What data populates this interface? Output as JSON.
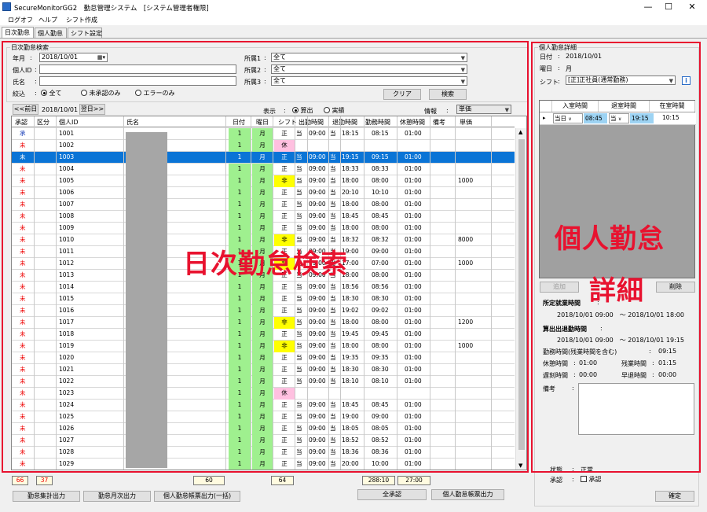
{
  "window": {
    "title": "SecureMonitorGG2　勤怠管理システム　[システム管理者権限]",
    "minimize": "—",
    "maximize": "☐",
    "close": "✕"
  },
  "menu": [
    "ログオフ",
    "ヘルプ",
    "シフト作成"
  ],
  "tabs": [
    "日次勤怠",
    "個人勤怠",
    "シフト設定"
  ],
  "overlays": {
    "search": "日次勤怠検索",
    "detail_line1": "個人勤怠",
    "detail_line2": "詳細"
  },
  "search": {
    "group_title": "日次勤怠検索",
    "year_month_label": "年月",
    "year_month_value": "2018/10/01",
    "personal_id_label": "個人ID",
    "name_label": "氏名",
    "filter_label": "絞込",
    "radio_all": "全て",
    "radio_unapproved": "未承認のみ",
    "radio_error": "エラーのみ",
    "dept1_label": "所属1",
    "dept2_label": "所属2",
    "dept3_label": "所属3",
    "dept1_value": "全て",
    "dept2_value": "全て",
    "dept3_value": "全て",
    "clear_button": "クリア",
    "search_button": "検索",
    "prev_day": "<<前日",
    "date_display": "2018/10/01",
    "next_day": "翌日>>",
    "display_label": "表示",
    "display_calc": "算出",
    "display_actual": "実績",
    "info_label": "情報",
    "info_value": "単価"
  },
  "columns": [
    "承認",
    "区分",
    "個人ID",
    "氏名",
    "日付",
    "曜日",
    "シフト",
    "出勤時間",
    "退勤時間",
    "勤務時間",
    "休憩時間",
    "備考",
    "単価"
  ],
  "rows": [
    {
      "approval": "承",
      "id": "1001",
      "date": "1",
      "dow": "月",
      "shift": "正",
      "shift_color": "",
      "in_flag": "当",
      "in": "09:00",
      "out_flag": "当",
      "out": "18:15",
      "work": "08:15",
      "rest": "01:00",
      "price": ""
    },
    {
      "approval": "未",
      "id": "1002",
      "date": "1",
      "dow": "月",
      "shift": "休",
      "shift_color": "pink",
      "in_flag": "",
      "in": "",
      "out_flag": "",
      "out": "",
      "work": "",
      "rest": "",
      "price": ""
    },
    {
      "approval": "未",
      "id": "1003",
      "date": "1",
      "dow": "月",
      "shift": "正",
      "shift_color": "",
      "in_flag": "当",
      "in": "09:00",
      "out_flag": "当",
      "out": "19:15",
      "work": "09:15",
      "rest": "01:00",
      "price": "",
      "selected": true
    },
    {
      "approval": "未",
      "id": "1004",
      "date": "1",
      "dow": "月",
      "shift": "正",
      "shift_color": "",
      "in_flag": "当",
      "in": "09:00",
      "out_flag": "当",
      "out": "18:33",
      "work": "08:33",
      "rest": "01:00",
      "price": ""
    },
    {
      "approval": "未",
      "id": "1005",
      "date": "1",
      "dow": "月",
      "shift": "非",
      "shift_color": "yellow",
      "in_flag": "当",
      "in": "09:00",
      "out_flag": "当",
      "out": "18:00",
      "work": "08:00",
      "rest": "01:00",
      "price": "1000"
    },
    {
      "approval": "未",
      "id": "1006",
      "date": "1",
      "dow": "月",
      "shift": "正",
      "shift_color": "",
      "in_flag": "当",
      "in": "09:00",
      "out_flag": "当",
      "out": "20:10",
      "work": "10:10",
      "rest": "01:00",
      "price": ""
    },
    {
      "approval": "未",
      "id": "1007",
      "date": "1",
      "dow": "月",
      "shift": "正",
      "shift_color": "",
      "in_flag": "当",
      "in": "09:00",
      "out_flag": "当",
      "out": "18:00",
      "work": "08:00",
      "rest": "01:00",
      "price": ""
    },
    {
      "approval": "未",
      "id": "1008",
      "date": "1",
      "dow": "月",
      "shift": "正",
      "shift_color": "",
      "in_flag": "当",
      "in": "09:00",
      "out_flag": "当",
      "out": "18:45",
      "work": "08:45",
      "rest": "01:00",
      "price": ""
    },
    {
      "approval": "未",
      "id": "1009",
      "date": "1",
      "dow": "月",
      "shift": "正",
      "shift_color": "",
      "in_flag": "当",
      "in": "09:00",
      "out_flag": "当",
      "out": "18:00",
      "work": "08:00",
      "rest": "01:00",
      "price": ""
    },
    {
      "approval": "未",
      "id": "1010",
      "date": "1",
      "dow": "月",
      "shift": "非",
      "shift_color": "yellow",
      "in_flag": "当",
      "in": "09:00",
      "out_flag": "当",
      "out": "18:32",
      "work": "08:32",
      "rest": "01:00",
      "price": "8000"
    },
    {
      "approval": "未",
      "id": "1011",
      "date": "1",
      "dow": "月",
      "shift": "正",
      "shift_color": "",
      "in_flag": "当",
      "in": "09:00",
      "out_flag": "当",
      "out": "19:00",
      "work": "09:00",
      "rest": "01:00",
      "price": ""
    },
    {
      "approval": "未",
      "id": "1012",
      "date": "1",
      "dow": "月",
      "shift": "非",
      "shift_color": "yellow",
      "in_flag": "当",
      "in": "09:00",
      "out_flag": "当",
      "out": "17:00",
      "work": "07:00",
      "rest": "01:00",
      "price": "1000"
    },
    {
      "approval": "未",
      "id": "1013",
      "date": "1",
      "dow": "月",
      "shift": "正",
      "shift_color": "",
      "in_flag": "当",
      "in": "09:00",
      "out_flag": "当",
      "out": "18:00",
      "work": "08:00",
      "rest": "01:00",
      "price": ""
    },
    {
      "approval": "未",
      "id": "1014",
      "date": "1",
      "dow": "月",
      "shift": "正",
      "shift_color": "",
      "in_flag": "当",
      "in": "09:00",
      "out_flag": "当",
      "out": "18:56",
      "work": "08:56",
      "rest": "01:00",
      "price": ""
    },
    {
      "approval": "未",
      "id": "1015",
      "date": "1",
      "dow": "月",
      "shift": "正",
      "shift_color": "",
      "in_flag": "当",
      "in": "09:00",
      "out_flag": "当",
      "out": "18:30",
      "work": "08:30",
      "rest": "01:00",
      "price": ""
    },
    {
      "approval": "未",
      "id": "1016",
      "date": "1",
      "dow": "月",
      "shift": "正",
      "shift_color": "",
      "in_flag": "当",
      "in": "09:00",
      "out_flag": "当",
      "out": "19:02",
      "work": "09:02",
      "rest": "01:00",
      "price": ""
    },
    {
      "approval": "未",
      "id": "1017",
      "date": "1",
      "dow": "月",
      "shift": "非",
      "shift_color": "yellow",
      "in_flag": "当",
      "in": "09:00",
      "out_flag": "当",
      "out": "18:00",
      "work": "08:00",
      "rest": "01:00",
      "price": "1200"
    },
    {
      "approval": "未",
      "id": "1018",
      "date": "1",
      "dow": "月",
      "shift": "正",
      "shift_color": "",
      "in_flag": "当",
      "in": "09:00",
      "out_flag": "当",
      "out": "19:45",
      "work": "09:45",
      "rest": "01:00",
      "price": ""
    },
    {
      "approval": "未",
      "id": "1019",
      "date": "1",
      "dow": "月",
      "shift": "非",
      "shift_color": "yellow",
      "in_flag": "当",
      "in": "09:00",
      "out_flag": "当",
      "out": "18:00",
      "work": "08:00",
      "rest": "01:00",
      "price": "1000"
    },
    {
      "approval": "未",
      "id": "1020",
      "date": "1",
      "dow": "月",
      "shift": "正",
      "shift_color": "",
      "in_flag": "当",
      "in": "09:00",
      "out_flag": "当",
      "out": "19:35",
      "work": "09:35",
      "rest": "01:00",
      "price": ""
    },
    {
      "approval": "未",
      "id": "1021",
      "date": "1",
      "dow": "月",
      "shift": "正",
      "shift_color": "",
      "in_flag": "当",
      "in": "09:00",
      "out_flag": "当",
      "out": "18:30",
      "work": "08:30",
      "rest": "01:00",
      "price": ""
    },
    {
      "approval": "未",
      "id": "1022",
      "date": "1",
      "dow": "月",
      "shift": "正",
      "shift_color": "",
      "in_flag": "当",
      "in": "09:00",
      "out_flag": "当",
      "out": "18:10",
      "work": "08:10",
      "rest": "01:00",
      "price": ""
    },
    {
      "approval": "未",
      "id": "1023",
      "date": "1",
      "dow": "月",
      "shift": "休",
      "shift_color": "pink",
      "in_flag": "",
      "in": "",
      "out_flag": "",
      "out": "",
      "work": "",
      "rest": "",
      "price": ""
    },
    {
      "approval": "未",
      "id": "1024",
      "date": "1",
      "dow": "月",
      "shift": "正",
      "shift_color": "",
      "in_flag": "当",
      "in": "09:00",
      "out_flag": "当",
      "out": "18:45",
      "work": "08:45",
      "rest": "01:00",
      "price": ""
    },
    {
      "approval": "未",
      "id": "1025",
      "date": "1",
      "dow": "月",
      "shift": "正",
      "shift_color": "",
      "in_flag": "当",
      "in": "09:00",
      "out_flag": "当",
      "out": "19:00",
      "work": "09:00",
      "rest": "01:00",
      "price": ""
    },
    {
      "approval": "未",
      "id": "1026",
      "date": "1",
      "dow": "月",
      "shift": "正",
      "shift_color": "",
      "in_flag": "当",
      "in": "09:00",
      "out_flag": "当",
      "out": "18:05",
      "work": "08:05",
      "rest": "01:00",
      "price": ""
    },
    {
      "approval": "未",
      "id": "1027",
      "date": "1",
      "dow": "月",
      "shift": "正",
      "shift_color": "",
      "in_flag": "当",
      "in": "09:00",
      "out_flag": "当",
      "out": "18:52",
      "work": "08:52",
      "rest": "01:00",
      "price": ""
    },
    {
      "approval": "未",
      "id": "1028",
      "date": "1",
      "dow": "月",
      "shift": "正",
      "shift_color": "",
      "in_flag": "当",
      "in": "09:00",
      "out_flag": "当",
      "out": "18:36",
      "work": "08:36",
      "rest": "01:00",
      "price": ""
    },
    {
      "approval": "未",
      "id": "1029",
      "date": "1",
      "dow": "月",
      "shift": "正",
      "shift_color": "",
      "in_flag": "当",
      "in": "09:00",
      "out_flag": "当",
      "out": "20:00",
      "work": "10:00",
      "rest": "01:00",
      "price": ""
    }
  ],
  "totals": {
    "approval_total": "66",
    "unapproved_total": "37",
    "date_total": "60",
    "shift_total": "64",
    "work_total": "288:10",
    "rest_total": "27:00"
  },
  "bottom_buttons": {
    "attendance_summary": "勤怠集計出力",
    "monthly": "勤怠月次出力",
    "personal_bulk": "個人勤怠帳票出力(一括)",
    "approve_all": "全承認",
    "personal_report": "個人勤怠帳票出力"
  },
  "detail": {
    "group_title": "個人勤怠詳細",
    "date_label": "日付",
    "date_value": "2018/10/01",
    "dow_label": "曜日",
    "dow_value": "月",
    "shift_label": "シフト",
    "shift_value": "[正]正社員(通常勤務)",
    "info_icon": "i",
    "grid_headers": [
      "入室時間",
      "退室時間",
      "在室時間"
    ],
    "row_marker": "▸",
    "row_in_flag": "当日",
    "row_in": "08:45",
    "row_out_flag": "当",
    "row_out": "19:15",
    "row_stay": "10:15",
    "add_button": "追加",
    "delete_button": "削除",
    "scheduled_label": "所定就業時間",
    "scheduled_value": "2018/10/01 09:00　～ 2018/10/01 18:00",
    "calc_label": "算出出退勤時間",
    "calc_value": "2018/10/01 09:00　～ 2018/10/01 19:15",
    "work_label": "勤務時間(残業時間を含む)",
    "work_value": "09:15",
    "rest_label": "休憩時間",
    "rest_value": "01:00",
    "overtime_label": "残業時間",
    "overtime_value": "01:15",
    "late_label": "遅刻時間",
    "late_value": "00:00",
    "early_label": "早退時間",
    "early_value": "00:00",
    "note_label": "備考",
    "status_label": "状態",
    "status_value": "正常",
    "approve_label": "承認",
    "approve_check_label": "承認",
    "confirm_button": "確定"
  }
}
